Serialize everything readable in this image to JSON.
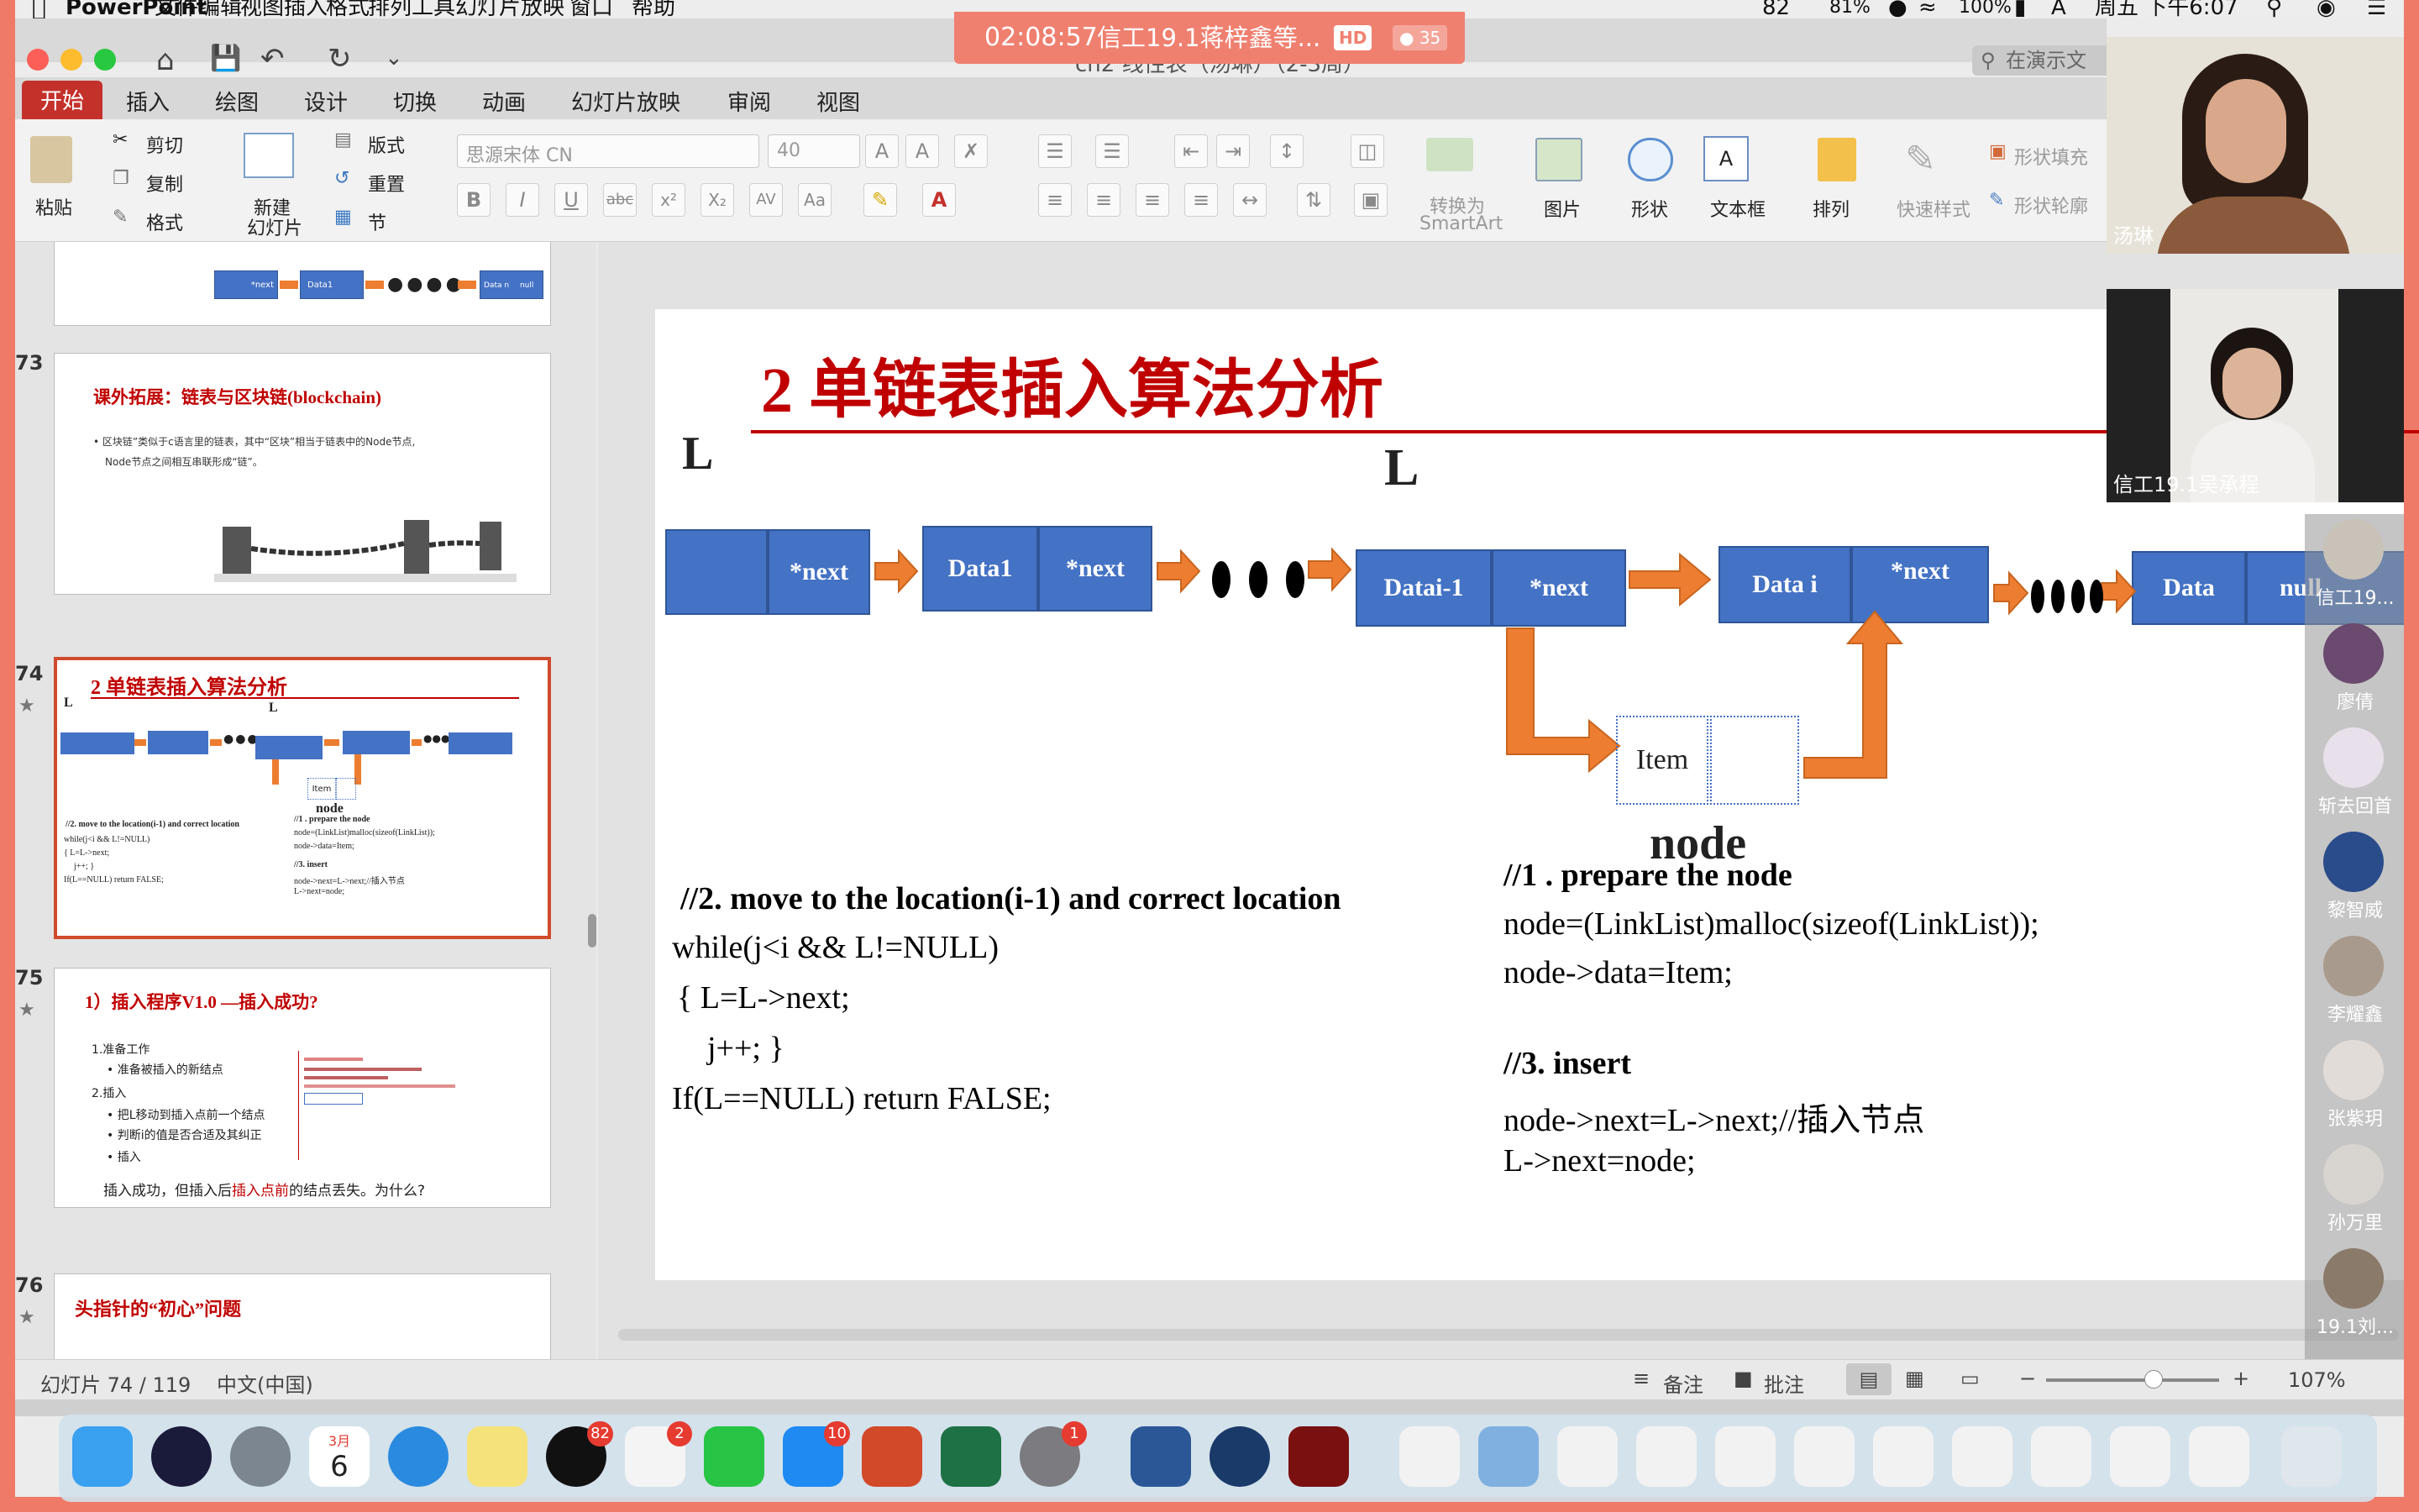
{
  "menubar": {
    "app": "PowerPoint",
    "items": [
      "文件",
      "编辑",
      "视图",
      "插入",
      "格式",
      "排列",
      "工具",
      "幻灯片放映",
      "窗口",
      "帮助"
    ],
    "battery_left": "82",
    "battery_right": "81%",
    "battery_pct": "100%",
    "clock": "周五 下午6:07"
  },
  "banner": {
    "time": "02:08:57",
    "title": "信工19.1蒋梓鑫等...",
    "hd": "HD",
    "participants": "35"
  },
  "window": {
    "title": "ch2 线性表（汤琳）（2-3周）",
    "search_placeholder": "在演示文"
  },
  "ribbon_tabs": [
    "开始",
    "插入",
    "绘图",
    "设计",
    "切换",
    "动画",
    "幻灯片放映",
    "审阅",
    "视图"
  ],
  "ribbon": {
    "paste": "粘贴",
    "cut": "剪切",
    "copy": "复制",
    "format": "格式",
    "new_slide_line1": "新建",
    "new_slide_line2": "幻灯片",
    "layout": "版式",
    "reset": "重置",
    "section": "节",
    "font_name": "思源宋体 CN",
    "font_size": "40",
    "smartart_line1": "转换为",
    "smartart_line2": "SmartArt",
    "picture": "图片",
    "shape": "形状",
    "textbox": "文本框",
    "arrange": "排列",
    "quick_style": "快速样式",
    "shape_fill": "形状填充",
    "shape_outline": "形状轮廓"
  },
  "thumbs": {
    "t72": {
      "node_next": "*next",
      "data1": "Data1",
      "data_n": "Data n",
      "null_label": "null"
    },
    "t73": {
      "num": "73",
      "title": "课外拓展：链表与区块链(blockchain)",
      "line1": "• 区块链”类似于c语言里的链表，其中“区块”相当于链表中的Node节点,",
      "line2": "Node节点之间相互串联形成“链”。"
    },
    "t74": {
      "num": "74",
      "title": "2 单链表插入算法分析",
      "l1": "L",
      "l2": "L",
      "item": "Item",
      "node": "node",
      "left1": "//2.  move to  the location(i-1) and correct location",
      "left2": "while(j<i && L!=NULL)",
      "left3": "{ L=L->next;",
      "left4": "j++; }",
      "left5": "If(L==NULL) return FALSE;",
      "right1": "//1 . prepare the node",
      "right2": "node=(LinkList)malloc(sizeof(LinkList));",
      "right3": "node->data=Item;",
      "right4": "//3. insert",
      "right5": "node->next=L->next;//插入节点",
      "right6": "L->next=node;"
    },
    "t75": {
      "num": "75",
      "title": "1）插入程序V1.0  —插入成功?",
      "s1": "1.准备工作",
      "s1a": "• 准备被插入的新结点",
      "s2": "2.插入",
      "s2a": "• 把L移动到插入点前一个结点",
      "s2b": "• 判断i的值是否合适及其纠正",
      "s2c": "• 插入",
      "footer_a": "插入成功，但插入后",
      "footer_b": "插入点前",
      "footer_c": "的结点丢失。为什么?"
    },
    "t76": {
      "num": "76",
      "title": "头指针的“初心”问题"
    }
  },
  "slide": {
    "title": "2 单链表插入算法分析",
    "l_left": "L",
    "l_mid": "L",
    "n_next1": "*next",
    "n_data1": "Data1",
    "n_next2": "*next",
    "n_datai1": "Datai-1",
    "n_next3": "*next",
    "n_datai": "Data i",
    "n_next4": "*next",
    "n_data": "Data",
    "n_null": "null",
    "item": "Item",
    "node_label": "node",
    "left_code": [
      "//2.  move to  the location(i-1) and correct location",
      "while(j<i && L!=NULL)",
      "{ L=L->next;",
      "j++; }",
      "If(L==NULL) return FALSE;"
    ],
    "right_code": [
      "//1 . prepare the node",
      "node=(LinkList)malloc(sizeof(LinkList));",
      "node->data=Item;",
      "//3. insert",
      "node->next=L->next;//插入节点",
      "L->next=node;"
    ]
  },
  "status": {
    "slide_info": "幻灯片 74 / 119",
    "language": "中文(中国)",
    "notes": "备注",
    "comments": "批注",
    "zoom": "107%",
    "zoom_fraction": 0.62
  },
  "video": {
    "tile1": "汤琳",
    "tile2": "信工19.1吴承程"
  },
  "participants": [
    "信工19...",
    "廖倩",
    "斩去回首",
    "黎智威",
    "李耀鑫",
    "张紫玥",
    "孙万里",
    "19.1刘..."
  ],
  "dock_badges": {
    "qq": "82",
    "reminders": "2",
    "appstore": "10",
    "sysprefs": "1"
  },
  "dock_calendar": {
    "month": "3月",
    "day": "6"
  },
  "colors": {
    "accent": "#c4312b",
    "frame": "#f07a68",
    "node_blue": "#4472c4",
    "arrow_orange": "#ed7d31",
    "title_red": "#c00000"
  }
}
